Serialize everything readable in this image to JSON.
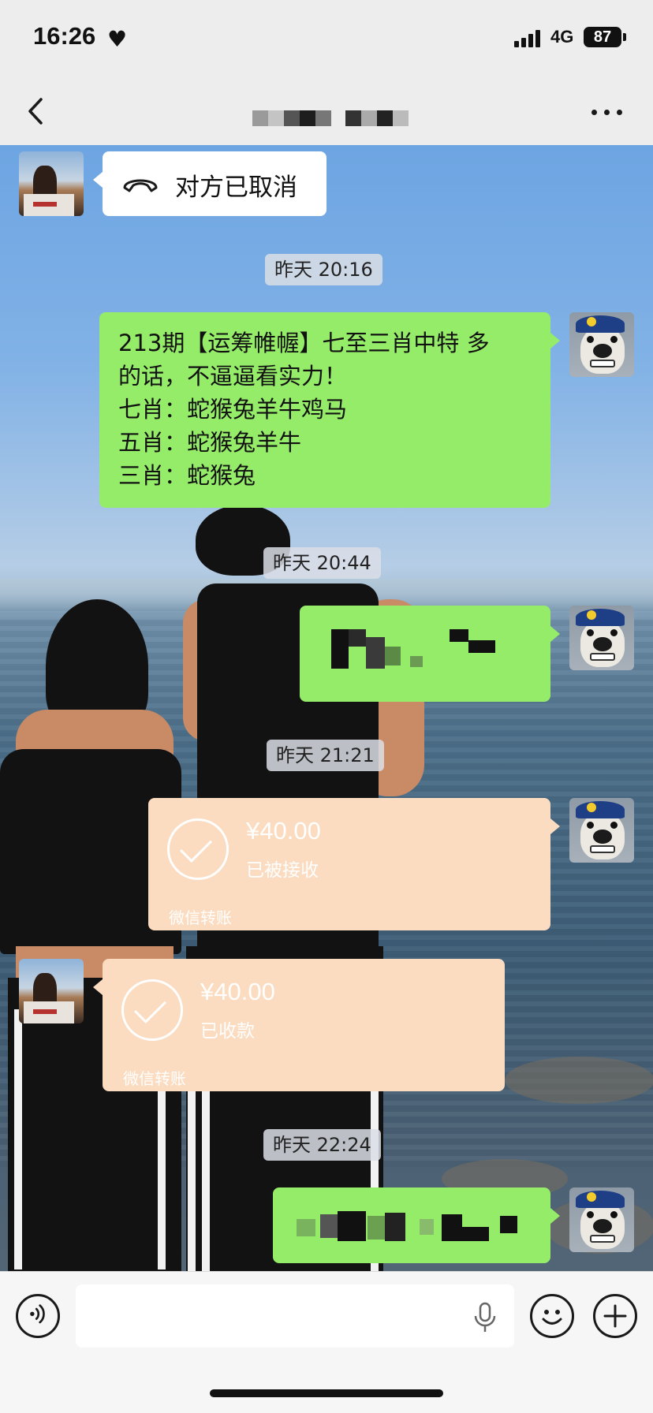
{
  "status_bar": {
    "time": "16:26",
    "heart_icon": "heart-icon",
    "network": "4G",
    "battery": "87"
  },
  "nav": {
    "back_icon": "chevron-left-icon",
    "title": "",
    "more_icon": "more-horizontal-icon"
  },
  "messages": [
    {
      "type": "call",
      "side": "left",
      "icon": "phone-hangup-icon",
      "text": "对方已取消"
    },
    {
      "type": "time",
      "text": "昨天 20:16"
    },
    {
      "type": "text",
      "side": "right",
      "lines": [
        "213期【运筹帷幄】七至三肖中特 多",
        "的话，不逼逼看实力！",
        "七肖：蛇猴兔羊牛鸡马",
        "五肖：蛇猴兔羊牛",
        "三肖：蛇猴兔"
      ]
    },
    {
      "type": "time",
      "text": "昨天 20:44"
    },
    {
      "type": "pixelated",
      "side": "right"
    },
    {
      "type": "time",
      "text": "昨天 21:21"
    },
    {
      "type": "transfer",
      "side": "right",
      "amount": "¥40.00",
      "status": "已被接收",
      "footer": "微信转账"
    },
    {
      "type": "transfer",
      "side": "left",
      "amount": "¥40.00",
      "status": "已收款",
      "footer": "微信转账"
    },
    {
      "type": "time",
      "text": "昨天 22:24"
    },
    {
      "type": "pixelated",
      "side": "right"
    }
  ],
  "input_bar": {
    "voice_icon": "voice-icon",
    "placeholder": "",
    "mic_icon": "microphone-icon",
    "emoji_icon": "emoji-icon",
    "plus_icon": "plus-icon"
  },
  "colors": {
    "bubble_green": "#95ec69",
    "transfer_peach": "#fbdcc0",
    "bar_gray": "#ededed"
  }
}
